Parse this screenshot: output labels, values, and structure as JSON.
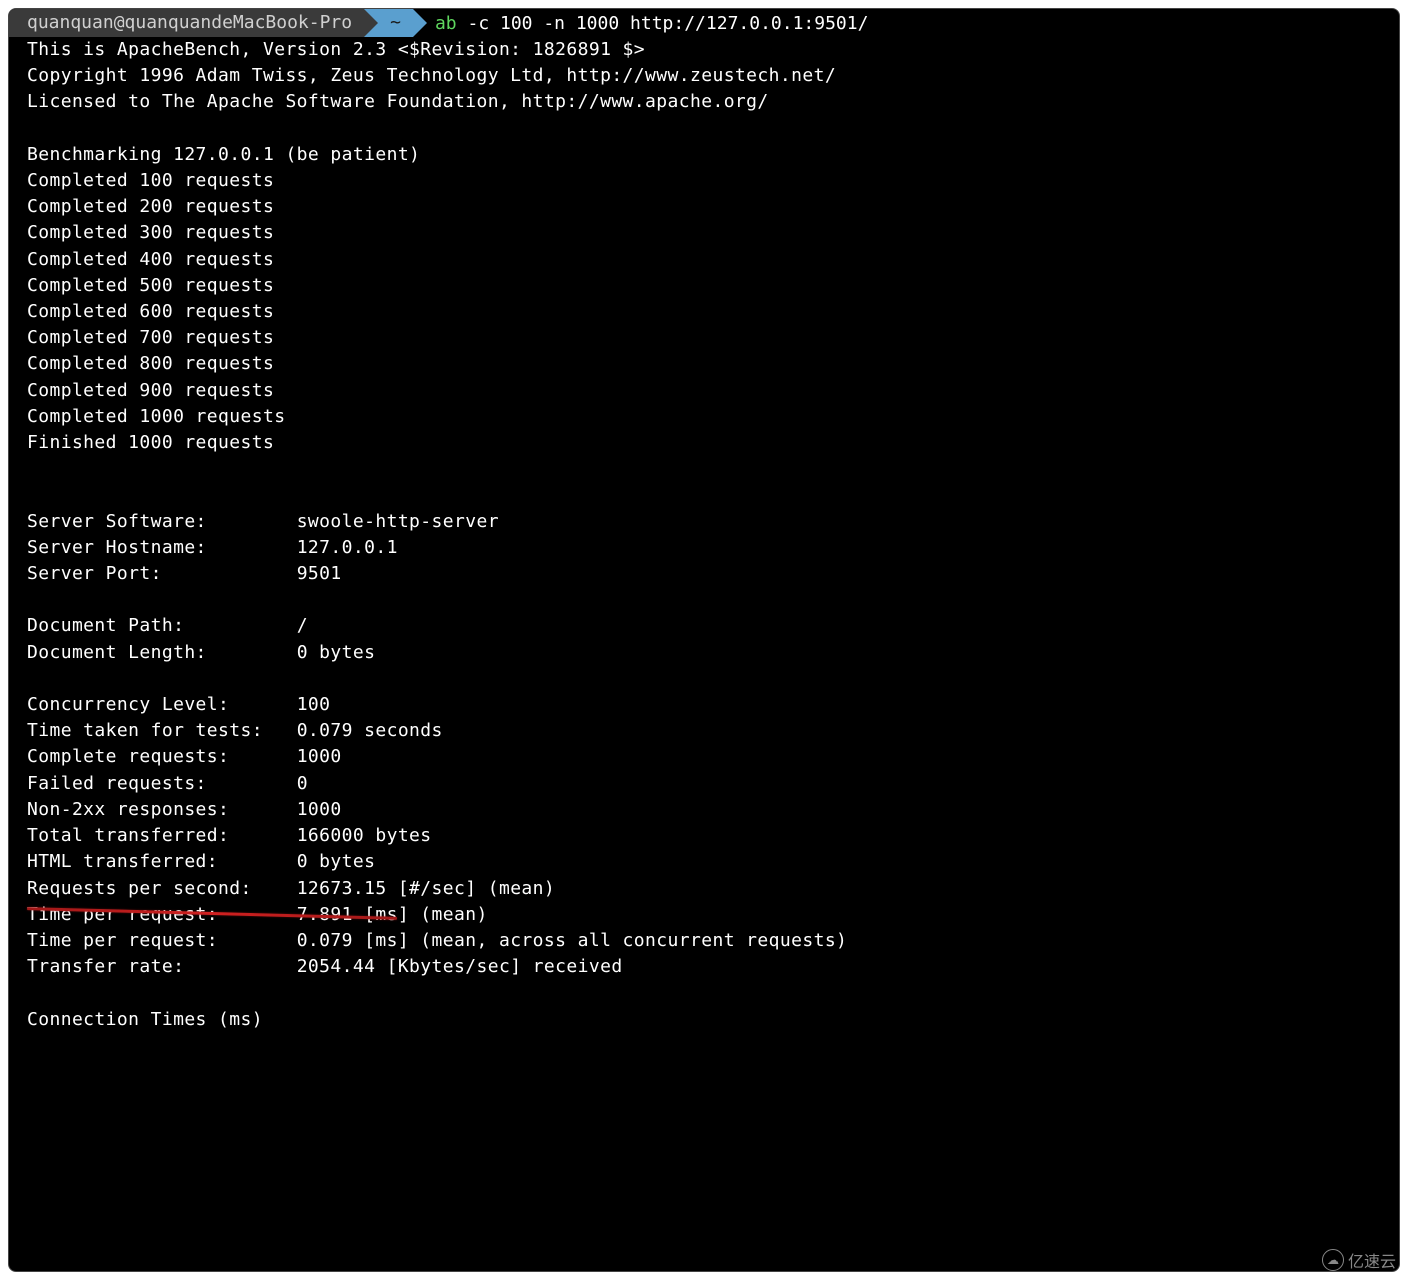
{
  "prompt": {
    "host": "quanquan@quanquandeMacBook-Pro",
    "dir": "~",
    "cmd": "ab",
    "args": " -c 100 -n 1000 http://127.0.0.1:9501/"
  },
  "header": {
    "l1": "This is ApacheBench, Version 2.3 <$Revision: 1826891 $>",
    "l2": "Copyright 1996 Adam Twiss, Zeus Technology Ltd, http://www.zeustech.net/",
    "l3": "Licensed to The Apache Software Foundation, http://www.apache.org/"
  },
  "bench": {
    "start": "Benchmarking 127.0.0.1 (be patient)",
    "p100": "Completed 100 requests",
    "p200": "Completed 200 requests",
    "p300": "Completed 300 requests",
    "p400": "Completed 400 requests",
    "p500": "Completed 500 requests",
    "p600": "Completed 600 requests",
    "p700": "Completed 700 requests",
    "p800": "Completed 800 requests",
    "p900": "Completed 900 requests",
    "p1000": "Completed 1000 requests",
    "done": "Finished 1000 requests"
  },
  "results": {
    "server_software": {
      "label": "Server Software:        ",
      "value": "swoole-http-server"
    },
    "server_hostname": {
      "label": "Server Hostname:        ",
      "value": "127.0.0.1"
    },
    "server_port": {
      "label": "Server Port:            ",
      "value": "9501"
    },
    "doc_path": {
      "label": "Document Path:          ",
      "value": "/"
    },
    "doc_length": {
      "label": "Document Length:        ",
      "value": "0 bytes"
    },
    "concurrency": {
      "label": "Concurrency Level:      ",
      "value": "100"
    },
    "time_taken": {
      "label": "Time taken for tests:   ",
      "value": "0.079 seconds"
    },
    "complete_req": {
      "label": "Complete requests:      ",
      "value": "1000"
    },
    "failed_req": {
      "label": "Failed requests:        ",
      "value": "0"
    },
    "non2xx": {
      "label": "Non-2xx responses:      ",
      "value": "1000"
    },
    "total_transferred": {
      "label": "Total transferred:      ",
      "value": "166000 bytes"
    },
    "html_transferred": {
      "label": "HTML transferred:       ",
      "value": "0 bytes"
    },
    "rps": {
      "label": "Requests per second:    ",
      "value": "12673.15 [#/sec] (mean)"
    },
    "tpr1": {
      "label": "Time per request:       ",
      "value": "7.891 [ms] (mean)"
    },
    "tpr2": {
      "label": "Time per request:       ",
      "value": "0.079 [ms] (mean, across all concurrent requests)"
    },
    "transfer_rate": {
      "label": "Transfer rate:          ",
      "value": "2054.44 [Kbytes/sec] received"
    }
  },
  "connection_times_header": "Connection Times (ms)",
  "watermark": "亿速云"
}
